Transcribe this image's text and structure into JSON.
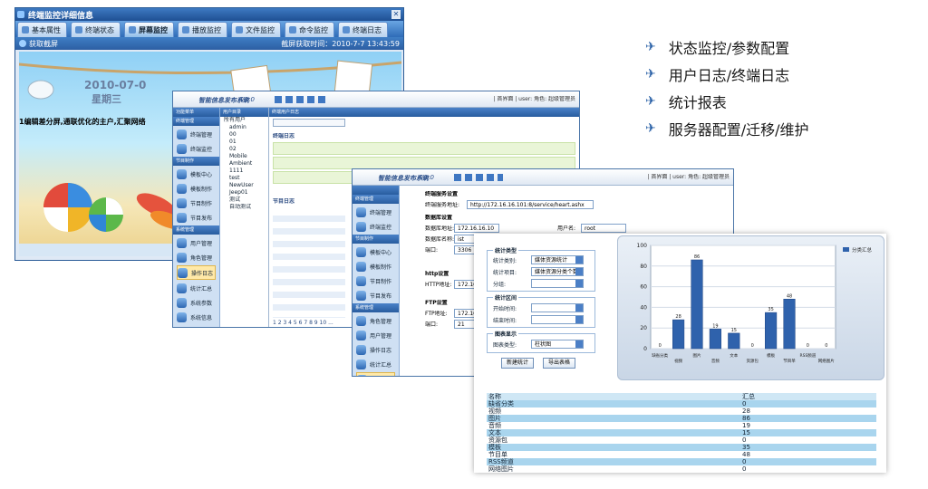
{
  "win1": {
    "title": "终端监控详细信息",
    "tabs": [
      {
        "label": "基本属性"
      },
      {
        "label": "终端状态"
      },
      {
        "label": "屏幕监控"
      },
      {
        "label": "播放监控"
      },
      {
        "label": "文件监控"
      },
      {
        "label": "命令监控"
      },
      {
        "label": "终端日志"
      }
    ],
    "refresh_label": "获取截屏",
    "capture_time": "截屏获取时间：2010-7-7 13:43:59",
    "screen": {
      "date": "2010-07-0",
      "weekday": "星期三",
      "marquee": "1编辑差分屏,通联优化的主户,汇聚网络"
    }
  },
  "win2": {
    "app_title": "智能信息发布系统",
    "version": "V1.0",
    "user_bar": "| 首界面 | user: 角色: 超级管理员",
    "nav_header": "功能菜单",
    "nav_groups": [
      {
        "title": "终端管理",
        "items": [
          "终端管理",
          "终端监控"
        ]
      },
      {
        "title": "节目制作",
        "items": [
          "模板中心",
          "模板制作",
          "节目制作",
          "节目发布"
        ]
      },
      {
        "title": "系统管理",
        "items": [
          "用户管理",
          "角色管理",
          "操作日志",
          "统计汇总",
          "系统参数",
          "系统信息"
        ]
      }
    ],
    "tree_header": "用户目录",
    "tree_items": [
      "所有用户",
      "admin",
      "00",
      "01",
      "02",
      "Mobile",
      "Ambient",
      "1111",
      "test",
      "NewUser",
      "Jeep01",
      "测试",
      "自动测试"
    ],
    "log_header": "终端用户日志",
    "log_sections": [
      "终端日志",
      "节目日志"
    ],
    "pager": "1 2 3 4 5 6 7 8 9 10 ..."
  },
  "win3": {
    "app_title": "智能信息发布系统",
    "version": "V1.0",
    "user_bar": "| 首界面 | user: 角色: 超级管理员",
    "nav_groups": [
      {
        "title": "终端管理",
        "items": [
          "终端管理",
          "终端监控"
        ]
      },
      {
        "title": "节目制作",
        "items": [
          "模板中心",
          "模板制作",
          "节目制作",
          "节目发布"
        ]
      },
      {
        "title": "系统管理",
        "items": [
          "角色管理",
          "用户管理",
          "操作日志",
          "统计汇总",
          "系统参数",
          "系统信息"
        ]
      }
    ],
    "form": {
      "section1": "终端服务设置",
      "url_label": "终端服务地址:",
      "url_value": "http://172.16.16.101:8/service/heart.ashx",
      "section2": "数据库设置",
      "db_addr_label": "数据库地址:",
      "db_addr_value": "172.16.16.10",
      "db_user_label": "用户名:",
      "db_user_value": "root",
      "db_name_label": "数据库名称:",
      "db_name_value": "ist",
      "port_label": "端口:",
      "port_value": "3306",
      "section3": "http设置",
      "http_label": "HTTP地址:",
      "http_value": "172.16.16.10",
      "section4": "FTP设置",
      "ftp_label": "FTP地址:",
      "ftp_value": "172.16.16.10",
      "ftp_port_label": "端口:",
      "ftp_port_value": "21"
    }
  },
  "panel": {
    "group1_title": "统计类型",
    "type_label": "统计类别:",
    "type_value": "媒体资源统计",
    "item_label": "统计项目:",
    "item_value": "媒体资源分类个数",
    "group_label": "分组:",
    "group_value": "",
    "group2_title": "统计区间",
    "start_label": "开始时间:",
    "end_label": "结束时间:",
    "group3_title": "图表显示",
    "chart_type_label": "图表类型:",
    "chart_type_value": "柱状图",
    "btn_new": "新建统计",
    "btn_export": "导出表格"
  },
  "chart_data": {
    "type": "bar",
    "categories": [
      "缺省分类",
      "视频",
      "图片",
      "音频",
      "文本",
      "资源包",
      "模板",
      "节目单",
      "RSS频道",
      "网络图片"
    ],
    "series": [
      {
        "name": "分类汇总",
        "values": [
          0,
          28,
          86,
          19,
          15,
          0,
          35,
          48,
          0,
          0
        ]
      }
    ],
    "ylim": [
      0,
      100
    ],
    "yticks": [
      0,
      20,
      40,
      60,
      80,
      100
    ],
    "grid": true,
    "legend": "top-right",
    "bar_color": "#2f62ac"
  },
  "table": {
    "headers": [
      "名称",
      "汇总"
    ],
    "rows": [
      [
        "缺省分类",
        "0"
      ],
      [
        "视频",
        "28"
      ],
      [
        "图片",
        "86"
      ],
      [
        "音频",
        "19"
      ],
      [
        "文本",
        "15"
      ],
      [
        "资源包",
        "0"
      ],
      [
        "模板",
        "35"
      ],
      [
        "节目单",
        "48"
      ],
      [
        "RSS频道",
        "0"
      ],
      [
        "网络图片",
        "0"
      ]
    ]
  },
  "bullets": [
    "状态监控/参数配置",
    "用户日志/终端日志",
    "统计报表",
    "服务器配置/迁移/维护"
  ]
}
